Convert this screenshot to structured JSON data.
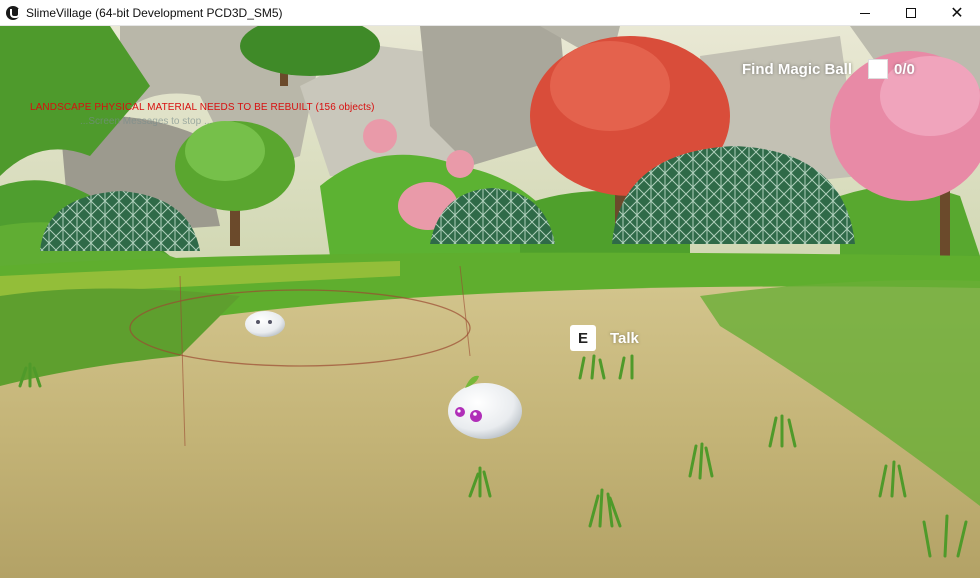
{
  "window": {
    "title": "SlimeVillage (64-bit Development PCD3D_SM5)",
    "app_icon": "unreal-engine-logo-icon",
    "controls": {
      "minimize": "minimize-icon",
      "maximize": "maximize-icon",
      "close_glyph": "✕"
    }
  },
  "debug": {
    "warning": "LANDSCAPE PHYSICAL MATERIAL NEEDS TO BE REBUILT (156 objects)",
    "sub": "...Screen Messages to stop ...",
    "warning_color": "#d80f0f"
  },
  "hud": {
    "quest_label": "Find Magic Ball",
    "quest_progress": "0/0",
    "quest_checked": false,
    "interact_key": "E",
    "interact_label": "Talk"
  },
  "colors": {
    "grass": "#5fae2e",
    "dirt": "#c2b37a",
    "dome": "#2e6b45",
    "pink_tree": "#e46d8a"
  }
}
